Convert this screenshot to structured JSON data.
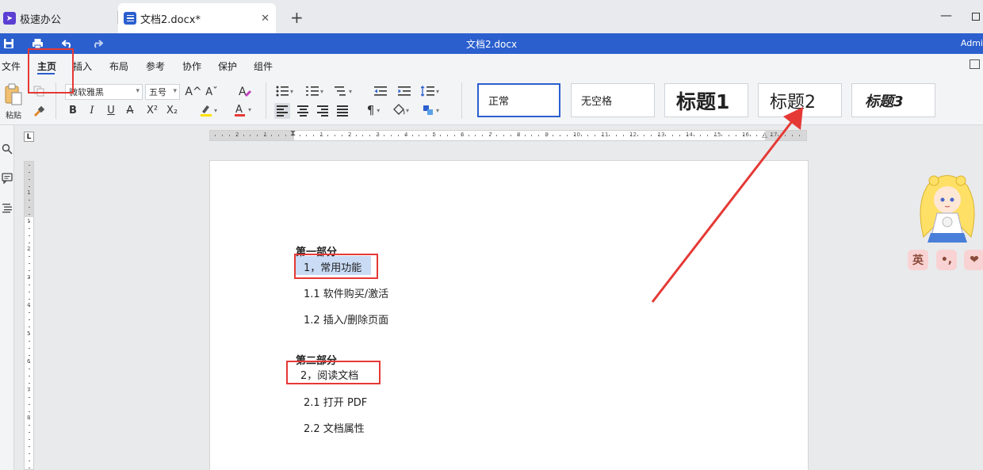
{
  "tabs": {
    "home_label": "极速办公",
    "doc_label": "文档2.docx*",
    "close_glyph": "✕",
    "new_tab_glyph": "+"
  },
  "window": {
    "minimize_glyph": "—"
  },
  "titlebar": {
    "doc_title": "文档2.docx",
    "user": "Admi"
  },
  "menu": {
    "items": [
      "文件",
      "主页",
      "插入",
      "布局",
      "参考",
      "协作",
      "保护",
      "组件"
    ],
    "active": "主页"
  },
  "ribbon": {
    "paste_label": "粘贴",
    "font_name": "微软雅黑",
    "font_size": "五号",
    "bold": "B",
    "italic": "I",
    "underline": "U",
    "strike": "A",
    "superscript": "X²",
    "subscript": "X₂",
    "grow_font": "A^",
    "shrink_font": "Aˇ",
    "font_color": "A",
    "paragraph_mark": "¶",
    "styles": [
      {
        "label": "正常"
      },
      {
        "label": "无空格"
      },
      {
        "label": "标题1"
      },
      {
        "label": "标题2"
      },
      {
        "label": "标题3"
      }
    ],
    "colors": {
      "accent": "#2b5fce",
      "highlight": "#ffe100",
      "font_color_bar": "#e53935"
    }
  },
  "sidebar": {
    "icons": [
      "search-icon",
      "comment-icon",
      "outline-icon"
    ]
  },
  "ruler": {
    "corner": "L",
    "h_numbers": [
      "2",
      "1",
      "1",
      "2",
      "3",
      "4",
      "5",
      "6",
      "7",
      "8",
      "9",
      "10",
      "11",
      "12",
      "13",
      "14",
      "15",
      "16",
      "17"
    ],
    "v_numbers": [
      "1",
      "1",
      "2",
      "3",
      "4",
      "5",
      "6",
      "7",
      "8"
    ]
  },
  "document": {
    "lines": [
      {
        "text": "第一部分",
        "kind": "heading"
      },
      {
        "text": "1，常用功能",
        "kind": "selected"
      },
      {
        "text": "1.1 软件购买/激活",
        "kind": "item"
      },
      {
        "text": "1.2 插入/删除页面",
        "kind": "item"
      },
      {
        "text": "第二部分",
        "kind": "heading"
      },
      {
        "text": "2，阅读文档",
        "kind": "item"
      },
      {
        "text": "2.1 打开 PDF",
        "kind": "item"
      },
      {
        "text": "2.2 文档属性",
        "kind": "item"
      }
    ]
  },
  "mascot": {
    "buttons": [
      "英",
      "•,",
      "❤"
    ]
  }
}
